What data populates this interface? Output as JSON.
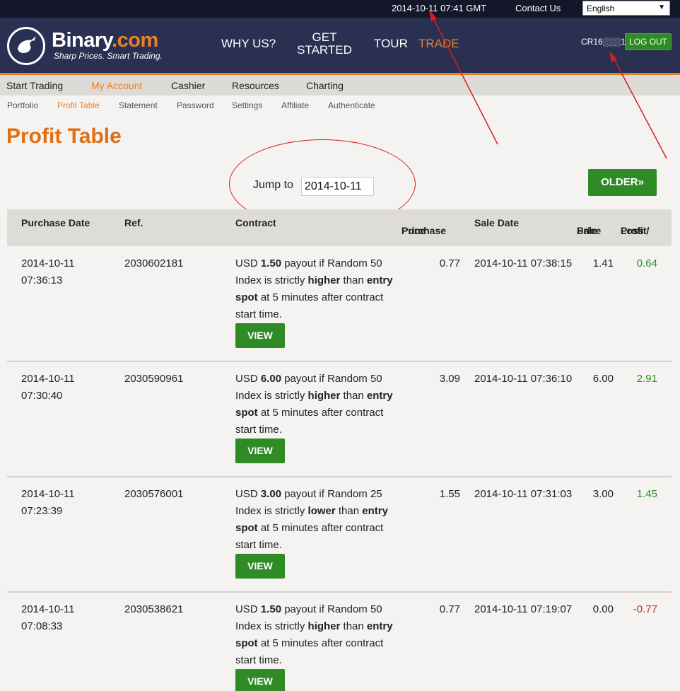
{
  "topbar": {
    "clock": "2014-10-11 07:41 GMT",
    "contact": "Contact Us",
    "language": "English"
  },
  "header": {
    "brand_main": "Binary",
    "brand_suffix": ".com",
    "tagline": "Sharp Prices. Smart Trading.",
    "nav": {
      "why": "WHY US?",
      "get_started_1": "GET",
      "get_started_2": "STARTED",
      "tour": "TOUR",
      "trade": "TRADE"
    },
    "account_id": "CR16░░░1",
    "logout": "LOG OUT"
  },
  "tabs": [
    "Start Trading",
    "My Account",
    "Cashier",
    "Resources",
    "Charting"
  ],
  "subtabs": [
    "Portfolio",
    "Profit Table",
    "Statement",
    "Password",
    "Settings",
    "Affiliate",
    "Authenticate"
  ],
  "page": {
    "title": "Profit Table",
    "jump_label": "Jump to",
    "jump_value": "2014-10-11",
    "older": "OLDER»"
  },
  "table": {
    "headers": {
      "purchase_date": "Purchase Date",
      "ref": "Ref.",
      "contract": "Contract",
      "purchase_price_1": "Purchase",
      "purchase_price_2": "Price",
      "sale_date": "Sale Date",
      "sale_price_1": "Sale",
      "sale_price_2": "Price",
      "profit_1": "Profit/",
      "profit_2": "Loss"
    },
    "view_label": "VIEW",
    "rows": [
      {
        "date_1": "2014-10-11",
        "date_2": "07:36:13",
        "ref": "2030602181",
        "c_pre": "USD ",
        "c_amount": "1.50",
        "c_mid": " payout if Random 50 Index is strictly ",
        "c_dir": "higher",
        "c_than": " than ",
        "c_spot": "entry spot",
        "c_post": " at 5 minutes after contract start time.",
        "purchase_price": "0.77",
        "sale_date": "2014-10-11 07:38:15",
        "sale_price": "1.41",
        "profit": "0.64"
      },
      {
        "date_1": "2014-10-11",
        "date_2": "07:30:40",
        "ref": "2030590961",
        "c_pre": "USD ",
        "c_amount": "6.00",
        "c_mid": " payout if Random 50 Index is strictly ",
        "c_dir": "higher",
        "c_than": " than ",
        "c_spot": "entry spot",
        "c_post": " at 5 minutes after contract start time.",
        "purchase_price": "3.09",
        "sale_date": "2014-10-11 07:36:10",
        "sale_price": "6.00",
        "profit": "2.91"
      },
      {
        "date_1": "2014-10-11",
        "date_2": "07:23:39",
        "ref": "2030576001",
        "c_pre": "USD ",
        "c_amount": "3.00",
        "c_mid": " payout if Random 25 Index is strictly ",
        "c_dir": "lower",
        "c_than": " than ",
        "c_spot": "entry spot",
        "c_post": " at 5 minutes after contract start time.",
        "purchase_price": "1.55",
        "sale_date": "2014-10-11 07:31:03",
        "sale_price": "3.00",
        "profit": "1.45"
      },
      {
        "date_1": "2014-10-11",
        "date_2": "07:08:33",
        "ref": "2030538621",
        "c_pre": "USD ",
        "c_amount": "1.50",
        "c_mid": " payout if Random 50 Index is strictly ",
        "c_dir": "higher",
        "c_than": " than ",
        "c_spot": "entry spot",
        "c_post": " at 5 minutes after contract start time.",
        "purchase_price": "0.77",
        "sale_date": "2014-10-11 07:19:07",
        "sale_price": "0.00",
        "profit": "-0.77"
      }
    ]
  },
  "colors": {
    "brand_orange": "#e98024",
    "header_navy": "#2a3052",
    "button_green": "#2e8b25",
    "loss_red": "#c62828",
    "annotation_red": "#d62020"
  }
}
